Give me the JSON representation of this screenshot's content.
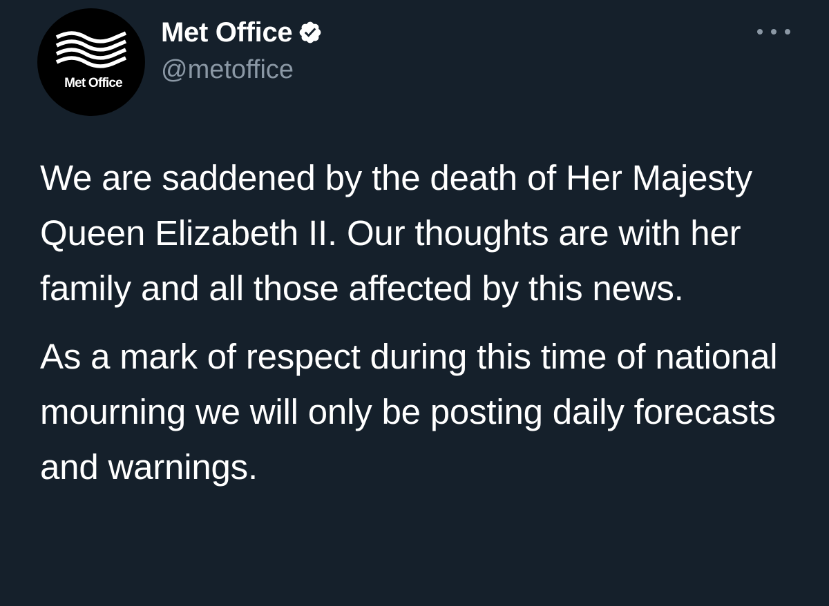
{
  "tweet": {
    "avatar_label": "Met Office",
    "display_name": "Met Office",
    "handle": "@metoffice",
    "paragraphs": [
      "We are saddened by the death of Her Majesty Queen Elizabeth II. Our thoughts are with her family and all those affected by this news.",
      "As a mark of respect during this time of national mourning we will only be posting daily forecasts and warnings."
    ]
  },
  "icons": {
    "avatar_logo": "wave-logo-icon",
    "verified": "verified-badge-icon",
    "more": "more-options-icon"
  },
  "colors": {
    "background": "#15202b",
    "text_primary": "#ffffff",
    "text_secondary": "#8b98a5"
  }
}
